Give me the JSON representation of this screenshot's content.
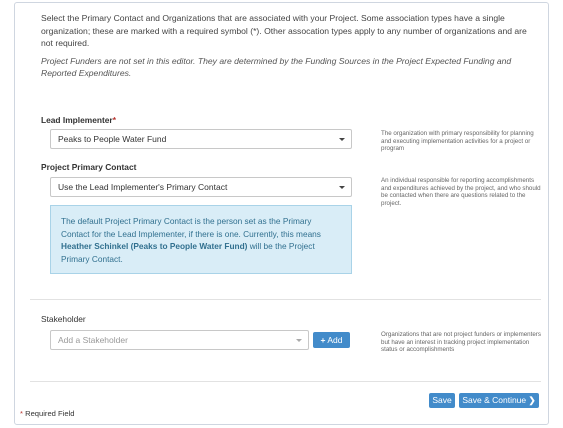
{
  "intro": {
    "text": "Select the Primary Contact and Organizations that are associated with your Project. Some association types have a single organization; these are marked with a required symbol (*). Other assocation types apply to any number of organizations and are not required.",
    "note": "Project Funders are not set in this editor. They are determined by the Funding Sources in the Project Expected Funding and Reported Expenditures."
  },
  "lead_implementer": {
    "label": "Lead Implementer",
    "required_mark": "*",
    "value": "Peaks to People Water Fund",
    "help": "The organization with primary responsibility for planning and executing implementation activities for a project or program"
  },
  "primary_contact": {
    "label": "Project Primary Contact",
    "value": "Use the Lead Implementer's Primary Contact",
    "help": "An individual responsible for reporting accomplishments and expenditures achieved by the project, and who should be contacted when there are questions related to the project.",
    "info_before": "The default Project Primary Contact is the person set as the Primary Contact for the Lead Implementer, if there is one. Currently, this means ",
    "info_bold": "Heather Schinkel (Peaks to People Water Fund)",
    "info_after": " will be the Project Primary Contact."
  },
  "stakeholder": {
    "label": "Stakeholder",
    "placeholder": "Add a Stakeholder",
    "add_label": "Add",
    "help": "Organizations that are not project funders or implementers but have an interest in tracking project implementation status or accomplishments"
  },
  "footer": {
    "save_label": "Save",
    "save_continue_label": "Save & Continue",
    "required_mark": "*",
    "required_note": "Required Field"
  },
  "colors": {
    "primary_button": "#428bca",
    "info_background": "#d9edf7",
    "info_text": "#31708f",
    "required": "#b7312c"
  }
}
